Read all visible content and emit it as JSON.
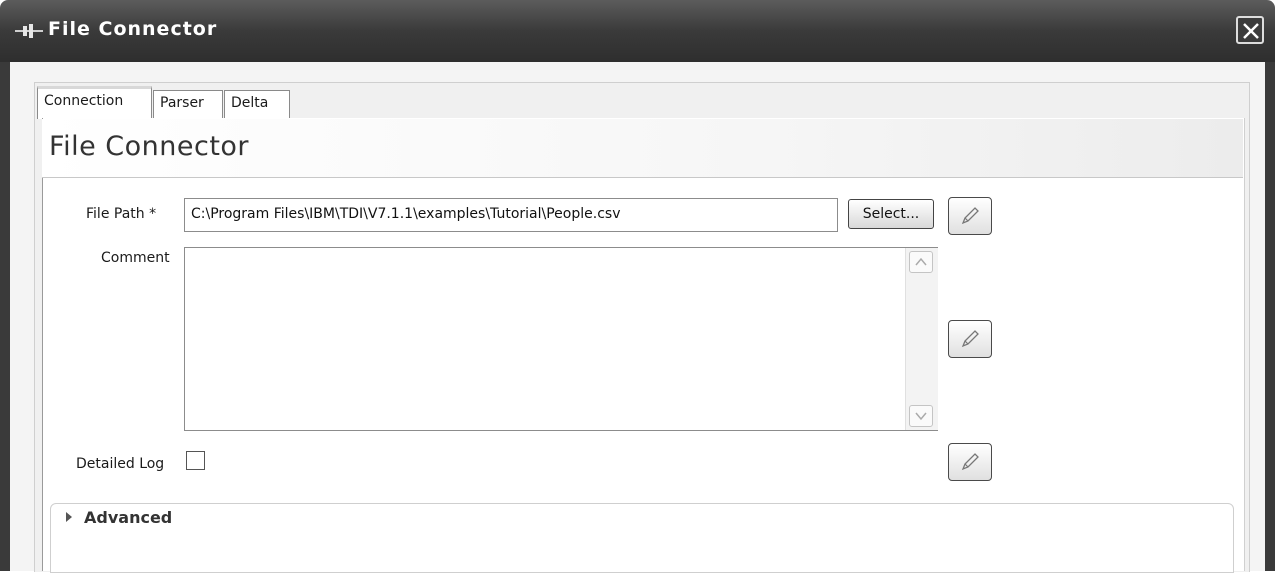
{
  "window": {
    "title": "File Connector",
    "close_icon": "close-icon",
    "app_icon": "connector-icon"
  },
  "tabs": [
    {
      "label": "Connection",
      "active": true
    },
    {
      "label": "Parser",
      "active": false
    },
    {
      "label": "Delta",
      "active": false
    }
  ],
  "section": {
    "title": "File Connector"
  },
  "form": {
    "file_path_label": "File Path *",
    "file_path_value": "C:\\Program Files\\IBM\\TDI\\V7.1.1\\examples\\Tutorial\\People.csv",
    "select_label": "Select...",
    "comment_label": "Comment",
    "comment_value": "",
    "detailed_log_label": "Detailed Log",
    "detailed_log_checked": false
  },
  "advanced": {
    "label": "Advanced",
    "expanded": false
  },
  "colors": {
    "titlebar": "#3a3a3a",
    "title_text": "#ffffff",
    "content_bg": "#ffffff"
  }
}
